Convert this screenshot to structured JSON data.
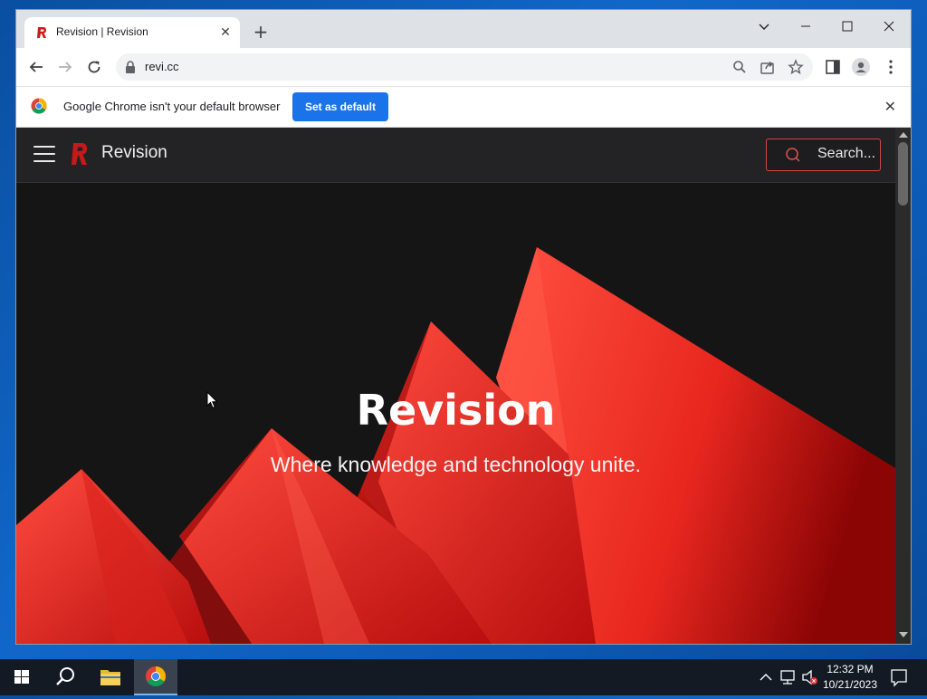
{
  "browser": {
    "tab_title": "Revision | Revision",
    "url": "revi.cc",
    "new_tab_symbol": "+",
    "window_controls": {
      "chevron": "chevron-down-icon",
      "minimize": "minimize-icon",
      "maximize": "maximize-icon",
      "close": "close-icon"
    }
  },
  "infobar": {
    "message": "Google Chrome isn't your default browser",
    "button_label": "Set as default"
  },
  "site": {
    "name": "Revision",
    "search_placeholder": "Search...",
    "accent_color": "#e53935"
  },
  "hero": {
    "title": "Revision",
    "subtitle": "Where knowledge and technology unite."
  },
  "taskbar": {
    "time": "12:32 PM",
    "date": "10/21/2023"
  }
}
